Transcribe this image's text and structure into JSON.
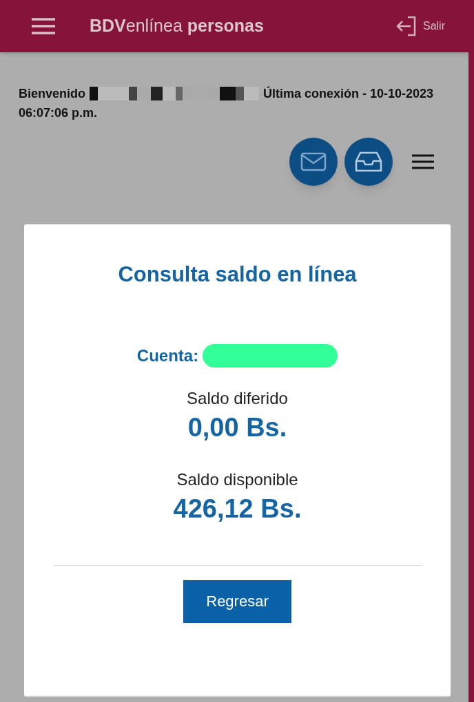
{
  "header": {
    "title": "**BDV**enlínea **personas**",
    "exit_label": "Salir"
  },
  "welcome": {
    "greeting": "Bienvenido",
    "last_login": "Última conexión - 10-10-2023",
    "last_login_time": "06:07:06 p.m."
  },
  "modal": {
    "title": "Consulta saldo en línea",
    "account_label": "Cuenta:",
    "balances": [
      {
        "label": "Saldo diferido",
        "value": "0,00 Bs."
      },
      {
        "label": "Saldo disponible",
        "value": "426,12 Bs."
      }
    ],
    "button": "Regresar"
  }
}
